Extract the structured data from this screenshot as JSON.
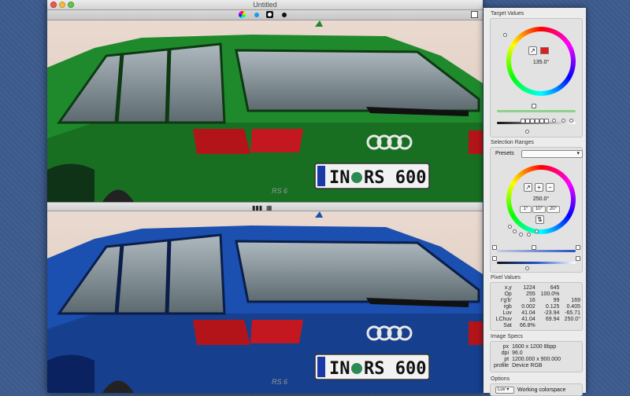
{
  "window": {
    "title": "Untitled"
  },
  "panel": {
    "target_values": {
      "title": "Target Values",
      "angle": "135.0°",
      "color": "#e21d1d"
    },
    "selection_ranges": {
      "title": "Selection Ranges",
      "presets_label": "Presets",
      "presets_value": "",
      "angle": "250.0°",
      "step_buttons": [
        "1°",
        "10°",
        "20°"
      ]
    },
    "pixel_values": {
      "title": "Pixel Values",
      "rows": [
        {
          "label": "x,y",
          "v1": "1224",
          "v2": "645",
          "v3": ""
        },
        {
          "label": "Op",
          "v1": "255",
          "v2": "100.0%",
          "v3": ""
        },
        {
          "label": "r'g'b'",
          "v1": "16",
          "v2": "99",
          "v3": "169"
        },
        {
          "label": "rgb",
          "v1": "0.002",
          "v2": "0.125",
          "v3": "0.405"
        },
        {
          "label": "Luv",
          "v1": "41.04",
          "v2": "-23.94",
          "v3": "-65.71"
        },
        {
          "label": "LChuv",
          "v1": "41.04",
          "v2": "69.94",
          "v3": "250.0°"
        },
        {
          "label": "Sat",
          "v1": "66.8%",
          "v2": "",
          "v3": ""
        }
      ]
    },
    "image_specs": {
      "title": "Image Specs",
      "rows": [
        {
          "label": "px",
          "value": "1600 x 1200 8bpp"
        },
        {
          "label": "dpi",
          "value": "96.0"
        },
        {
          "label": "pt",
          "value": "1200.000 x 900.000"
        },
        {
          "label": "profile",
          "value": "Device RGB"
        }
      ]
    },
    "options": {
      "title": "Options",
      "select_value": "Luv",
      "colorspace_label": "Working colorspace"
    }
  },
  "car": {
    "plate": "IN RS 600",
    "plate_left": "IN",
    "plate_right": "RS 600",
    "badge": "RS 6",
    "top_color": "#1f8a2c",
    "bottom_color": "#1b4fb0"
  }
}
